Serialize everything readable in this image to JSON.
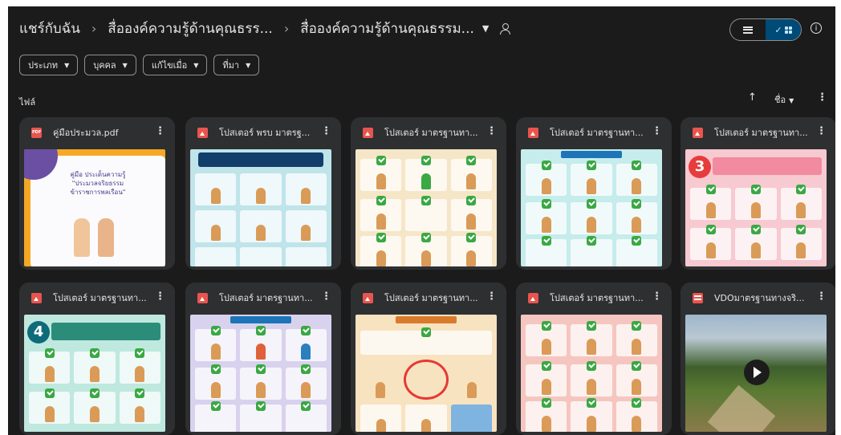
{
  "breadcrumb": {
    "items": [
      "แชร์กับฉัน",
      "สื่อองค์ความรู้ด้านคุณธรร...",
      "สื่อองค์ความรู้ด้านคุณธรรม..."
    ],
    "separator": "›"
  },
  "filters": [
    {
      "label": "ประเภท"
    },
    {
      "label": "บุคคล"
    },
    {
      "label": "แก้ไขเมื่อ"
    },
    {
      "label": "ที่มา"
    }
  ],
  "section": {
    "files_label": "ไฟล์",
    "sort_label": "ชื่อ"
  },
  "view": {
    "mode": "grid",
    "accent": "#004a77"
  },
  "files": [
    {
      "name": "คู่มือประมวล.pdf",
      "type": "pdf-icon",
      "thumb_title": "คู่มือ ประเด็นความรู้ \"ประมวลจริยธรรม ข้าราชการพลเรือน\""
    },
    {
      "name": "โปสเตอร์ พรบ มาตรฐ...",
      "type": "image-icon"
    },
    {
      "name": "โปสเตอร์ มาตรฐานทา...",
      "type": "image-icon"
    },
    {
      "name": "โปสเตอร์ มาตรฐานทา...",
      "type": "image-icon"
    },
    {
      "name": "โปสเตอร์ มาตรฐานทา...",
      "type": "image-icon",
      "thumb_number": "3"
    },
    {
      "name": "โปสเตอร์ มาตรฐานทา...",
      "type": "image-icon",
      "thumb_number": "4"
    },
    {
      "name": "โปสเตอร์ มาตรฐานทา...",
      "type": "image-icon"
    },
    {
      "name": "โปสเตอร์ มาตรฐานทา...",
      "type": "image-icon"
    },
    {
      "name": "โปสเตอร์ มาตรฐานทา...",
      "type": "image-icon"
    },
    {
      "name": "VDOมาตรฐานทางจริ...",
      "type": "video-icon"
    }
  ]
}
